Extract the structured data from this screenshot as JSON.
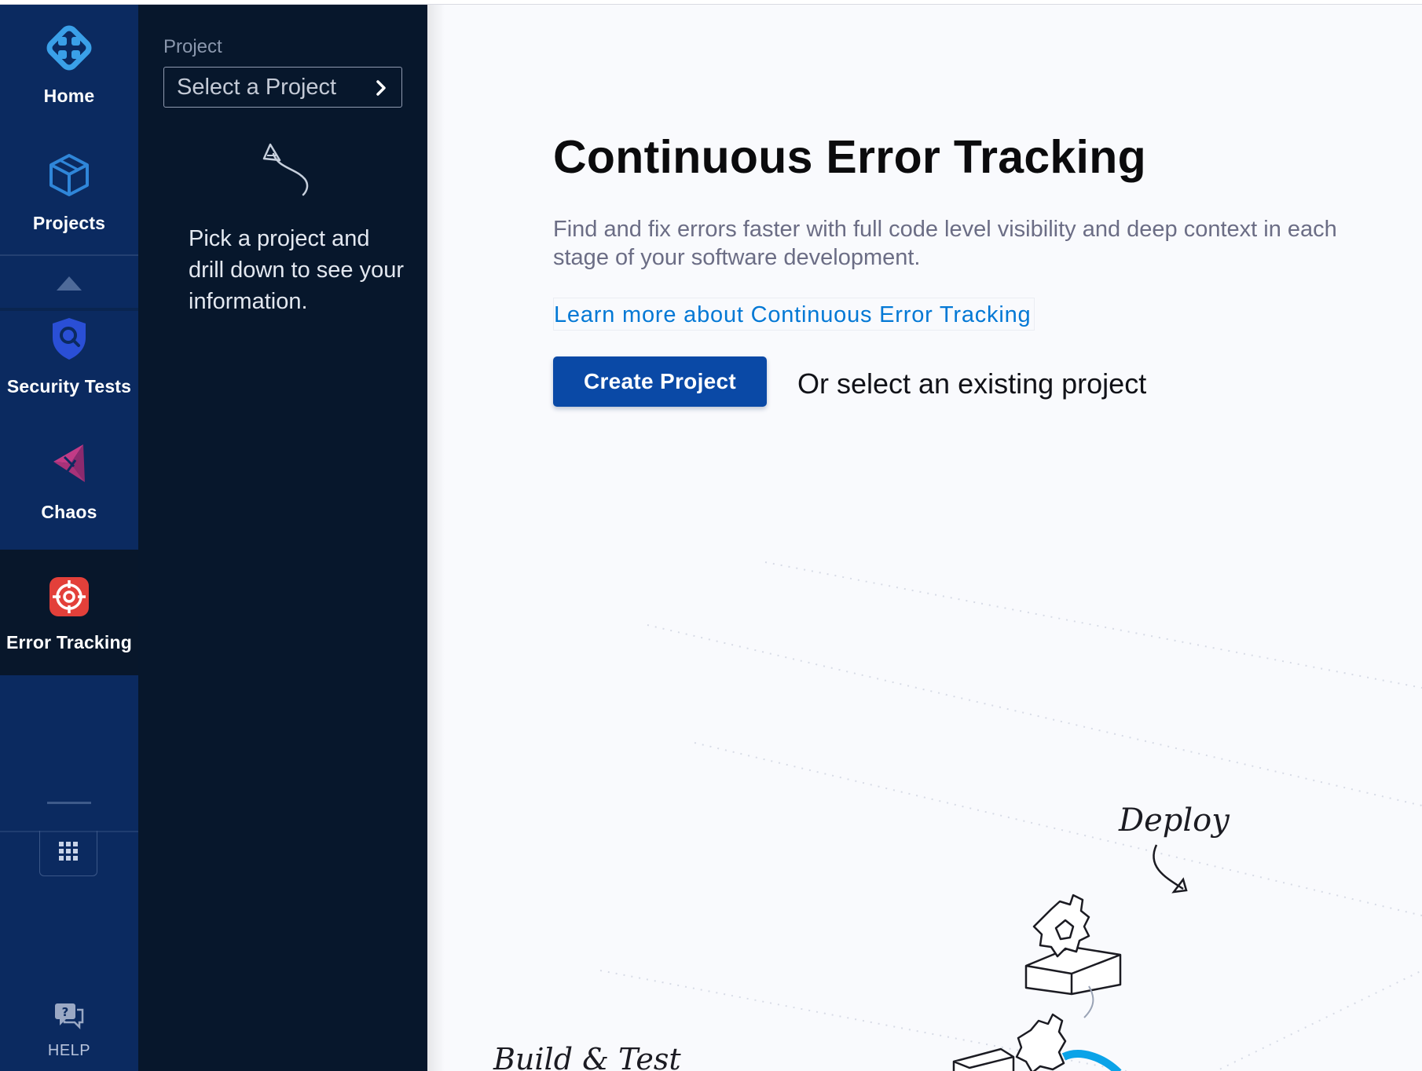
{
  "nav": {
    "items": [
      {
        "label": "Home",
        "icon": "harness-logo-icon"
      },
      {
        "label": "Projects",
        "icon": "cube-icon"
      },
      {
        "label": "Security Tests",
        "icon": "shield-icon"
      },
      {
        "label": "Chaos",
        "icon": "chaos-icon"
      },
      {
        "label": "Error Tracking",
        "icon": "target-icon",
        "active": true
      }
    ],
    "help_label": "HELP"
  },
  "project_panel": {
    "label": "Project",
    "select_placeholder": "Select a Project",
    "hint": "Pick a project and drill down to see your information."
  },
  "main": {
    "title": "Continuous Error Tracking",
    "description": "Find and fix errors faster with full code level visibility and deep context in each stage of your software development.",
    "learn_more_link": "Learn more about Continuous Error Tracking",
    "create_button": "Create Project",
    "or_select_text": "Or select an existing project"
  },
  "illustration": {
    "deploy_label": "Deploy",
    "build_label": "Build & Test"
  },
  "colors": {
    "rail_bg": "#0b2a60",
    "panel_bg": "#07172c",
    "primary_button": "#0a49a6",
    "link": "#0278d5",
    "error_tracking_accent": "#e3403a"
  }
}
